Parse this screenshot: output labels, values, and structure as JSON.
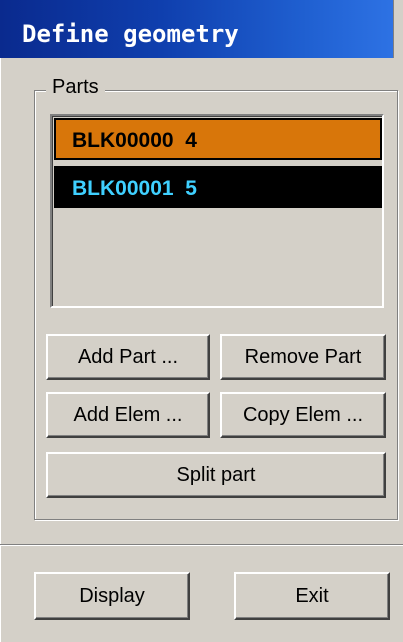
{
  "window": {
    "title": "Define geometry"
  },
  "parts_group": {
    "label": "Parts",
    "items": [
      {
        "label": "BLK00000  4",
        "selected": true,
        "color": "#d8760a"
      },
      {
        "label": "BLK00001  5",
        "selected": false,
        "color": "#000000",
        "text_color": "#3fd0ff"
      }
    ],
    "buttons": {
      "add_part": "Add Part ...",
      "remove_part": "Remove Part",
      "add_elem": "Add Elem ...",
      "copy_elem": "Copy Elem ...",
      "split_part": "Split part"
    }
  },
  "footer": {
    "display": "Display",
    "exit": "Exit"
  },
  "colors": {
    "title_bar": "#0f3fae",
    "panel": "#d4d0c8",
    "selected_item": "#d8760a",
    "item_text_cyan": "#3fd0ff"
  }
}
